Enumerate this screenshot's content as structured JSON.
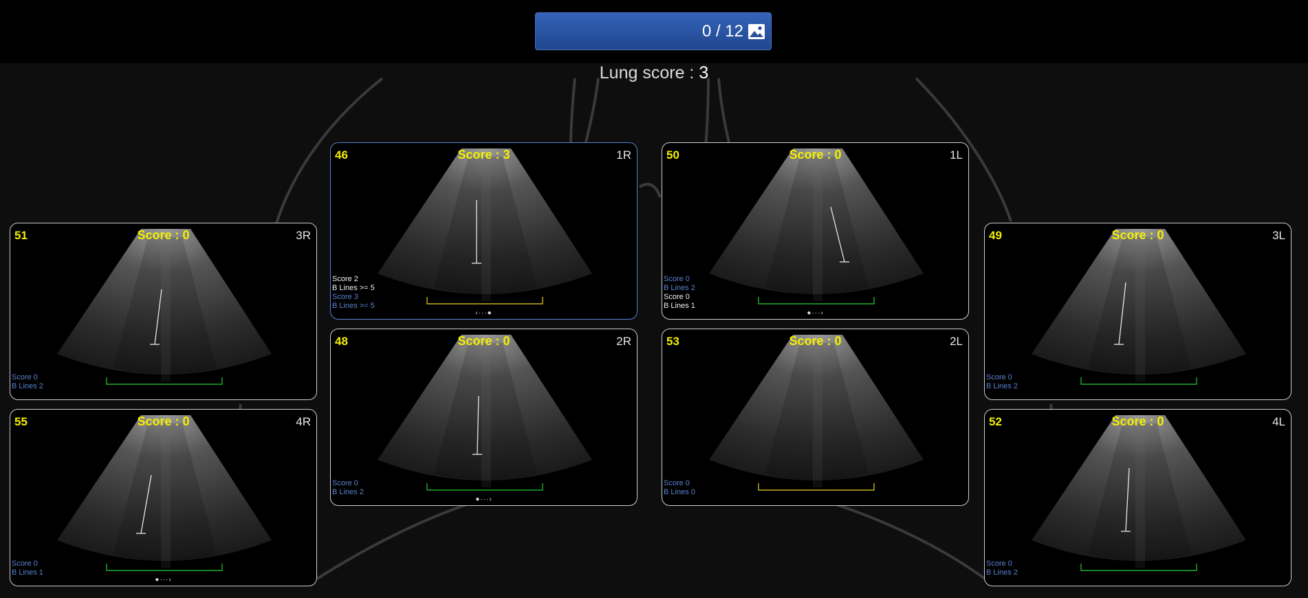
{
  "header": {
    "counter": "0 / 12",
    "gallery_icon": "image-gallery-icon"
  },
  "lung_score": {
    "label": "Lung score : ",
    "value": "3"
  },
  "tiles": [
    {
      "num": "51",
      "score": "Score : 0",
      "zone": "3R",
      "ann": [
        {
          "t": "Score 0",
          "c": "blue"
        },
        {
          "t": "B Lines 2",
          "c": "blue"
        }
      ],
      "pager": ""
    },
    {
      "num": "55",
      "score": "Score : 0",
      "zone": "4R",
      "ann": [
        {
          "t": "Score 0",
          "c": "blue"
        },
        {
          "t": "B Lines 1",
          "c": "blue"
        }
      ],
      "pager": "●···›"
    },
    {
      "num": "46",
      "score": "Score : 3",
      "zone": "1R",
      "ann": [
        {
          "t": "Score 2",
          "c": "white"
        },
        {
          "t": "B Lines  >= 5",
          "c": "white"
        },
        {
          "t": "Score 3",
          "c": "blue"
        },
        {
          "t": "B Lines  >= 5",
          "c": "blue"
        }
      ],
      "pager": "‹···●"
    },
    {
      "num": "48",
      "score": "Score : 0",
      "zone": "2R",
      "ann": [
        {
          "t": "Score 0",
          "c": "blue"
        },
        {
          "t": "B Lines 2",
          "c": "blue"
        }
      ],
      "pager": "●···›"
    },
    {
      "num": "50",
      "score": "Score : 0",
      "zone": "1L",
      "ann": [
        {
          "t": "Score 0",
          "c": "blue"
        },
        {
          "t": "B Lines 2",
          "c": "blue"
        },
        {
          "t": "Score 0",
          "c": "white"
        },
        {
          "t": "B Lines 1",
          "c": "white"
        }
      ],
      "pager": "●···›"
    },
    {
      "num": "53",
      "score": "Score : 0",
      "zone": "2L",
      "ann": [
        {
          "t": "Score 0",
          "c": "blue"
        },
        {
          "t": "B Lines 0",
          "c": "blue"
        }
      ],
      "pager": ""
    },
    {
      "num": "49",
      "score": "Score : 0",
      "zone": "3L",
      "ann": [
        {
          "t": "Score 0",
          "c": "blue"
        },
        {
          "t": "B Lines 2",
          "c": "blue"
        }
      ],
      "pager": ""
    },
    {
      "num": "52",
      "score": "Score : 0",
      "zone": "4L",
      "ann": [
        {
          "t": "Score 0",
          "c": "blue"
        },
        {
          "t": "B Lines 2",
          "c": "blue"
        }
      ],
      "pager": ""
    }
  ],
  "colors": {
    "accent": "#2d5bb0",
    "score_text": "#f5f000",
    "annotation_blue": "#5a82d2",
    "selected_border": "#5b83d6"
  }
}
